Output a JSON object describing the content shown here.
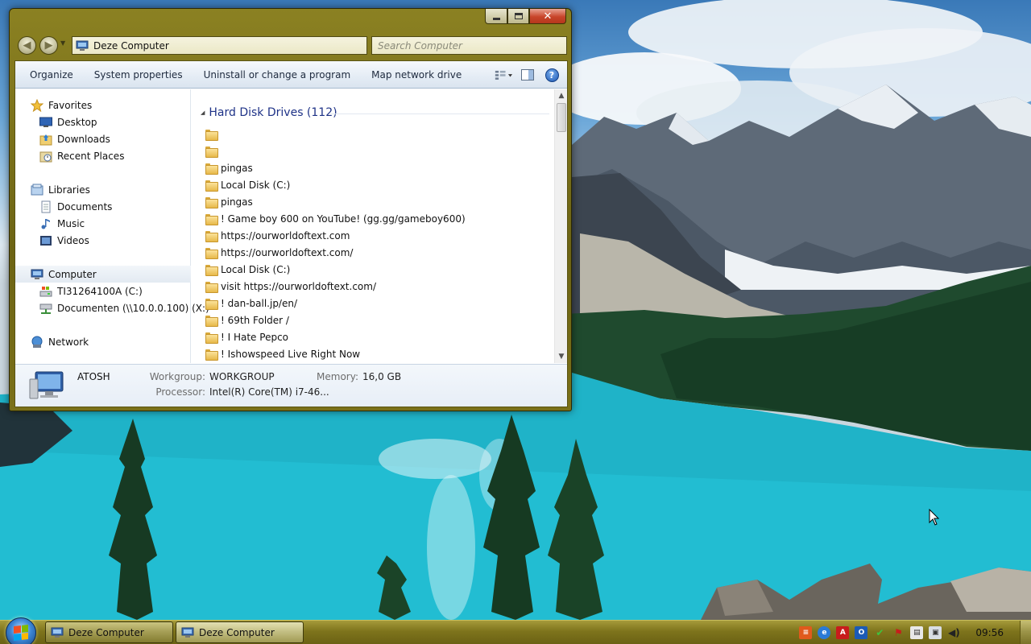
{
  "window": {
    "address": "Deze Computer",
    "search_placeholder": "Search Computer"
  },
  "toolbar": {
    "items": [
      "Organize",
      "System properties",
      "Uninstall or change a program",
      "Map network drive"
    ]
  },
  "nav": {
    "favorites": {
      "label": "Favorites",
      "icon": "star-icon",
      "items": [
        {
          "label": "Desktop",
          "icon": "desktop-icon"
        },
        {
          "label": "Downloads",
          "icon": "downloads-icon"
        },
        {
          "label": "Recent Places",
          "icon": "recent-places-icon"
        }
      ]
    },
    "libraries": {
      "label": "Libraries",
      "icon": "libraries-icon",
      "items": [
        {
          "label": "Documents",
          "icon": "documents-icon"
        },
        {
          "label": "Music",
          "icon": "music-icon"
        },
        {
          "label": "Videos",
          "icon": "videos-icon"
        }
      ]
    },
    "computer": {
      "label": "Computer",
      "icon": "computer-icon",
      "items": [
        {
          "label": "TI31264100A (C:)",
          "icon": "drive-icon"
        },
        {
          "label": "Documenten (\\\\10.0.0.100) (X:)",
          "icon": "network-drive-icon"
        }
      ]
    },
    "network": {
      "label": "Network",
      "icon": "network-icon"
    }
  },
  "content": {
    "group_title": "Hard Disk Drives (112)",
    "items": [
      "",
      "",
      "pingas",
      "Local Disk (C:)",
      "pingas",
      "! Game boy 600 on YouTube! (gg.gg/gameboy600)",
      "https://ourworldoftext.com",
      "https://ourworldoftext.com/",
      "Local Disk (C:)",
      "visit https://ourworldoftext.com/",
      "! dan-ball.jp/en/",
      "! 69th Folder /",
      "! I Hate Pepco",
      "! Ishowspeed Live Right Now"
    ]
  },
  "details": {
    "name": "ATOSH",
    "workgroup_label": "Workgroup:",
    "workgroup_value": "WORKGROUP",
    "memory_label": "Memory:",
    "memory_value": "16,0 GB",
    "processor_label": "Processor:",
    "processor_value": "Intel(R) Core(TM) i7-46..."
  },
  "taskbar": {
    "buttons": [
      "Deze Computer",
      "Deze Computer"
    ],
    "clock": "09:56",
    "tray_icons": [
      "orange-app-icon",
      "ie-icon",
      "acrobat-icon",
      "outlook-icon",
      "check-icon",
      "flag-icon",
      "clipboard-icon",
      "network-tray-icon",
      "volume-icon"
    ]
  },
  "colors": {
    "frame": "#7a7019",
    "taskbar": "#7e741c",
    "group_title": "#1e3287"
  }
}
